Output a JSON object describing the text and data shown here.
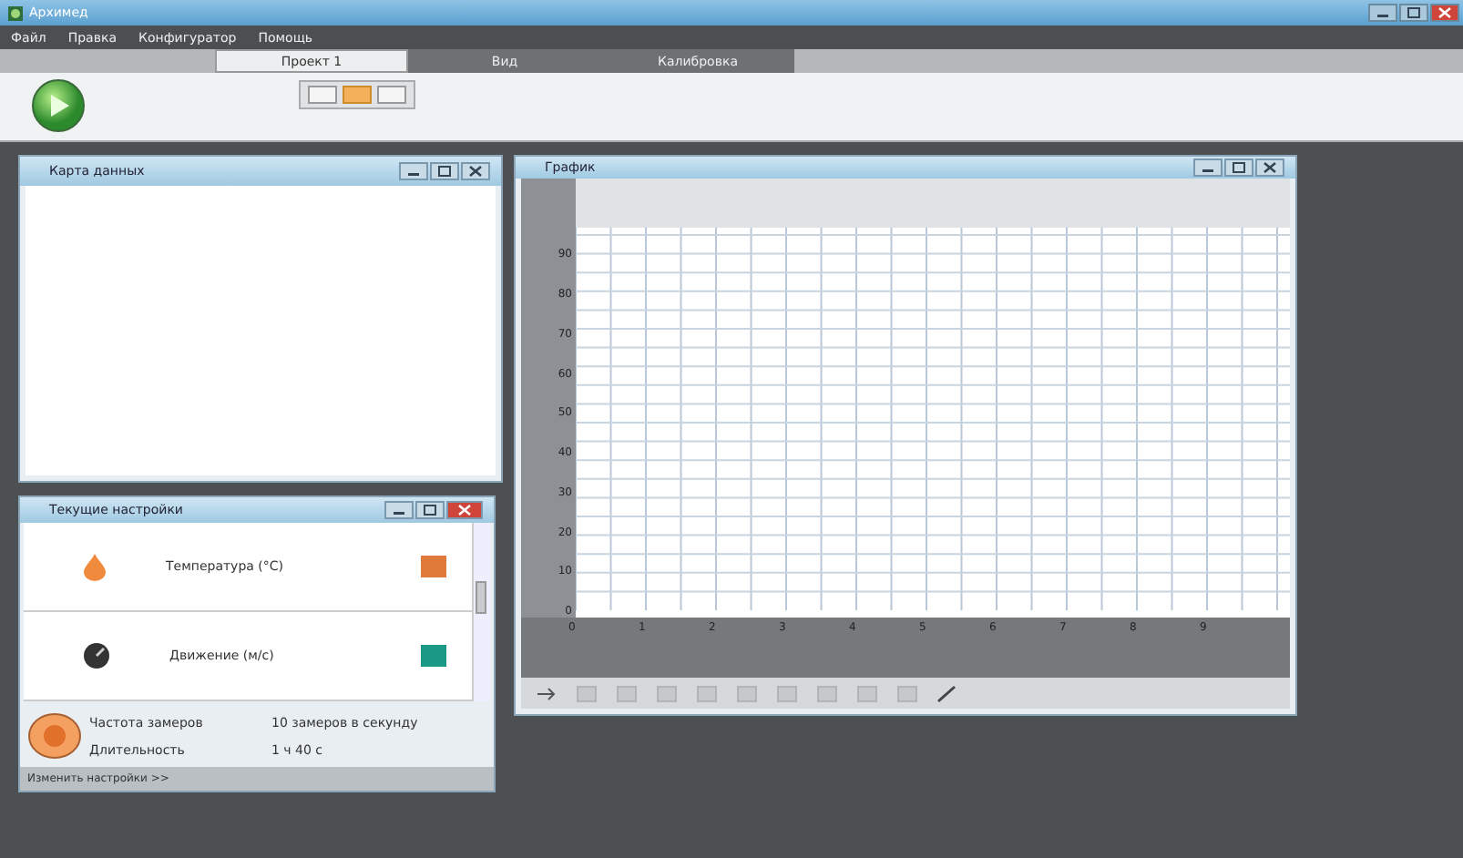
{
  "window": {
    "title": "Архимед"
  },
  "menu": [
    "Файл",
    "Правка",
    "Конфигуратор",
    "Помощь"
  ],
  "tabs": [
    {
      "label": "Проект 1",
      "selected": true
    },
    {
      "label": "Вид",
      "selected": false
    },
    {
      "label": "Калибровка",
      "selected": false
    }
  ],
  "view_modes": [
    {
      "selected": false
    },
    {
      "selected": true
    },
    {
      "selected": false
    }
  ],
  "data_map": {
    "title": "Карта данных"
  },
  "graph": {
    "title": "График",
    "y_labels": [
      "90",
      "80",
      "70",
      "60",
      "50",
      "40",
      "30",
      "20",
      "10",
      "0"
    ],
    "x_labels": [
      "0",
      "1",
      "2",
      "3",
      "4",
      "5",
      "6",
      "7",
      "8",
      "9"
    ]
  },
  "settings": {
    "title": "Текущие настройки",
    "sensors": [
      {
        "kind": "temperature",
        "name": "Температура (°С)",
        "color": "#e07a3a"
      },
      {
        "kind": "motion",
        "name": "Движение (м/с)",
        "color": "#1a9a86"
      }
    ],
    "rate_label": "Частота замеров",
    "rate_value": "10 замеров в секунду",
    "duration_label": "Длительность",
    "duration_value": "1 ч 40 с",
    "change_link": "Изменить настройки >>"
  }
}
